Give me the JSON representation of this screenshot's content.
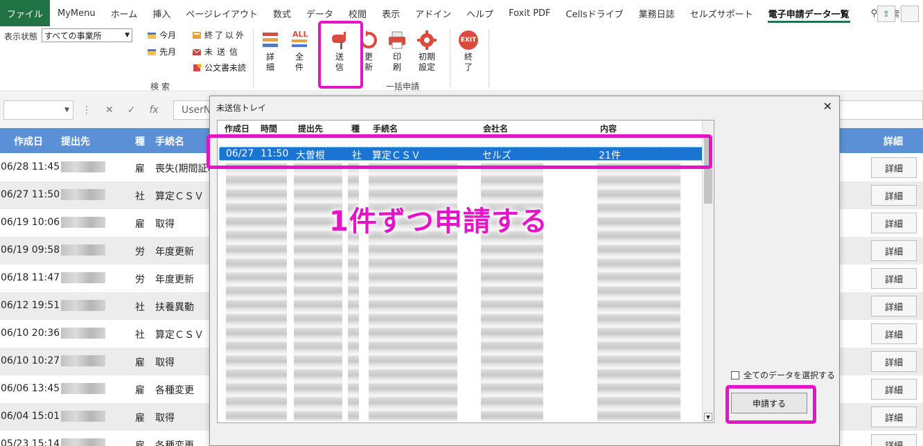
{
  "tabs": [
    {
      "label": "ファイル",
      "cls": "file"
    },
    {
      "label": "MyMenu"
    },
    {
      "label": "ホーム"
    },
    {
      "label": "挿入"
    },
    {
      "label": "ページレイアウト"
    },
    {
      "label": "数式"
    },
    {
      "label": "データ"
    },
    {
      "label": "校閲"
    },
    {
      "label": "表示"
    },
    {
      "label": "アドイン"
    },
    {
      "label": "ヘルプ"
    },
    {
      "label": "Foxit PDF"
    },
    {
      "label": "Cellsドライブ"
    },
    {
      "label": "業務日誌"
    },
    {
      "label": "セルズサポート"
    },
    {
      "label": "電子申請データ一覧",
      "cls": "active"
    }
  ],
  "search_label": "検索",
  "ribbon": {
    "display_state_label": "表示状態",
    "display_state_value": "すべての事業所",
    "today": "今月",
    "last_month": "先月",
    "except_done": "終了以外",
    "unsent": "未送信",
    "unread": "公文書未読",
    "detail_top": "詳",
    "detail_bot": "細",
    "all_icon_text": "ALL",
    "all_top": "全",
    "all_bot": "件",
    "send_top": "送",
    "send_bot": "信",
    "update_top": "更",
    "update_bot": "新",
    "print_top": "印",
    "print_bot": "刷",
    "init_top": "初期",
    "init_bot": "設定",
    "exit_icon_text": "EXIT",
    "end_top": "終",
    "end_bot": "了",
    "group_search": "検 索",
    "group_batch": "一括申請"
  },
  "formula": {
    "fx": "fx",
    "value": "UserN"
  },
  "sheet": {
    "headers": {
      "date": "作成日",
      "dest": "提出先",
      "kind": "種",
      "proc": "手続名",
      "detail": "詳細"
    },
    "rows": [
      {
        "date": "06/28 11:45",
        "kind": "雇",
        "proc": "喪失(期間証明"
      },
      {
        "date": "06/27 11:50",
        "kind": "社",
        "proc": "算定ＣＳＶ"
      },
      {
        "date": "06/19 10:06",
        "kind": "雇",
        "proc": "取得"
      },
      {
        "date": "06/19 09:58",
        "kind": "労",
        "proc": "年度更新"
      },
      {
        "date": "06/18 11:47",
        "kind": "労",
        "proc": "年度更新"
      },
      {
        "date": "06/12 19:51",
        "kind": "社",
        "proc": "扶養異動"
      },
      {
        "date": "06/10 20:36",
        "kind": "社",
        "proc": "算定ＣＳＶ"
      },
      {
        "date": "06/10 10:27",
        "kind": "雇",
        "proc": "取得"
      },
      {
        "date": "06/06 13:45",
        "kind": "雇",
        "proc": "各種変更"
      },
      {
        "date": "06/04 15:01",
        "kind": "雇",
        "proc": "取得"
      },
      {
        "date": "05/23 15:14",
        "kind": "雇",
        "proc": "各種変更"
      }
    ],
    "detail_label": "詳細"
  },
  "dialog": {
    "title": "未送信トレイ",
    "close": "✕",
    "headers": {
      "date": "作成日",
      "time": "時間",
      "dest": "提出先",
      "kind": "種",
      "proc": "手続名",
      "company": "会社名",
      "content": "内容"
    },
    "selected": {
      "date": "06/27",
      "time": "11:50",
      "dest": "大曽根",
      "kind": "社",
      "proc": "算定ＣＳＶ",
      "company": "セルズ",
      "content": "21件"
    },
    "callout": "1件ずつ申請する",
    "select_all": "全てのデータを選択する",
    "apply": "申請する"
  },
  "colors": {
    "excel_green": "#217346",
    "header_blue": "#5b8fd6",
    "selection_blue": "#1c74d2",
    "highlight_magenta": "#e415c8"
  }
}
